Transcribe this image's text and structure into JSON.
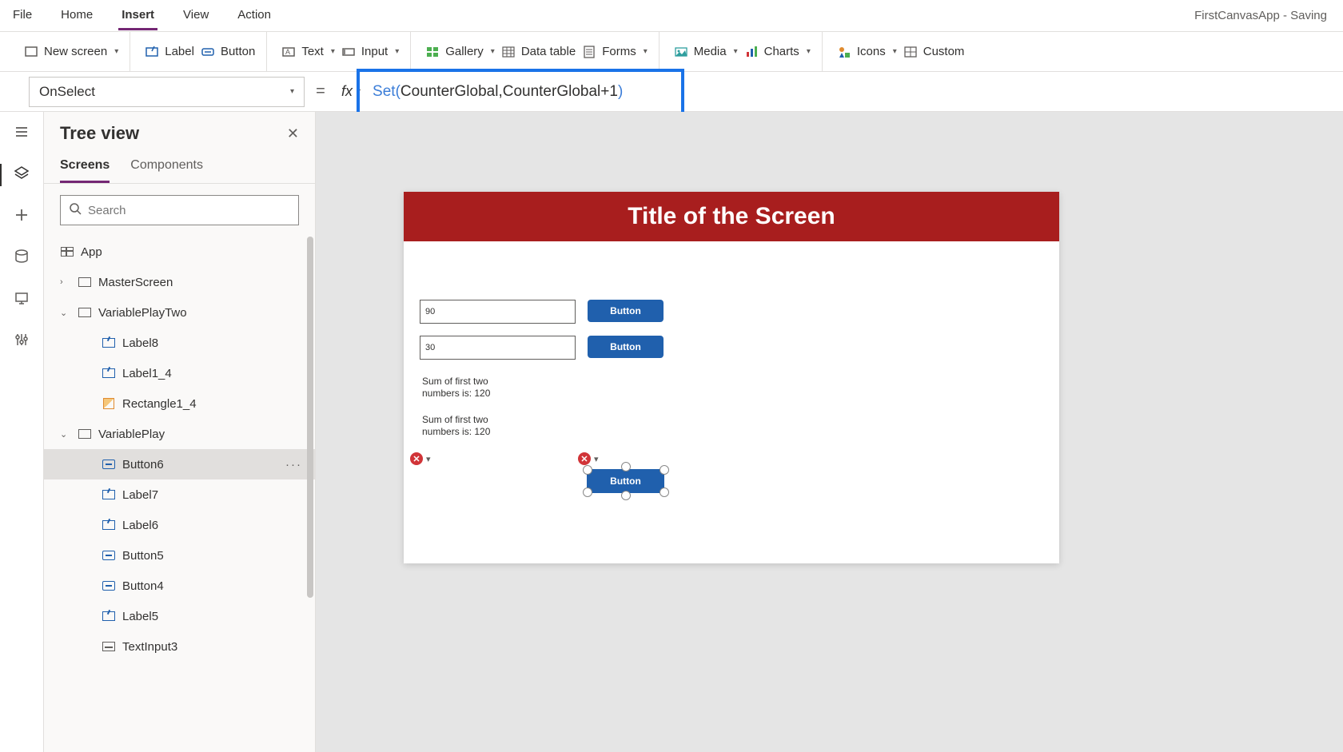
{
  "menubar": {
    "tabs": [
      "File",
      "Home",
      "Insert",
      "View",
      "Action"
    ],
    "active_index": 2,
    "app_status": "FirstCanvasApp - Saving"
  },
  "ribbon": {
    "groups": [
      {
        "items": [
          {
            "icon": "newscreen",
            "label": "New screen",
            "dropdown": true
          }
        ]
      },
      {
        "items": [
          {
            "icon": "label",
            "label": "Label",
            "dropdown": false
          },
          {
            "icon": "button",
            "label": "Button",
            "dropdown": false
          }
        ]
      },
      {
        "items": [
          {
            "icon": "text",
            "label": "Text",
            "dropdown": true
          },
          {
            "icon": "input",
            "label": "Input",
            "dropdown": true
          }
        ]
      },
      {
        "items": [
          {
            "icon": "gallery",
            "label": "Gallery",
            "dropdown": true
          },
          {
            "icon": "datatable",
            "label": "Data table",
            "dropdown": false
          },
          {
            "icon": "forms",
            "label": "Forms",
            "dropdown": true
          }
        ]
      },
      {
        "items": [
          {
            "icon": "media",
            "label": "Media",
            "dropdown": true
          },
          {
            "icon": "charts",
            "label": "Charts",
            "dropdown": true
          }
        ]
      },
      {
        "items": [
          {
            "icon": "icons",
            "label": "Icons",
            "dropdown": true
          },
          {
            "icon": "custom",
            "label": "Custom",
            "dropdown": false
          }
        ]
      }
    ]
  },
  "formulabar": {
    "property": "OnSelect",
    "equals": "=",
    "fx": "fx",
    "formula_parts": [
      {
        "t": "fn",
        "v": "Set"
      },
      {
        "t": "paren",
        "v": "("
      },
      {
        "t": "id",
        "v": "CounterGlobal"
      },
      {
        "t": "op",
        "v": ", "
      },
      {
        "t": "id",
        "v": "CounterGlobal"
      },
      {
        "t": "op",
        "v": " + "
      },
      {
        "t": "num",
        "v": "1"
      },
      {
        "t": "paren",
        "v": ")"
      }
    ]
  },
  "leftrail": {
    "buttons": [
      "hamburger",
      "layers",
      "plus",
      "data",
      "monitor",
      "settings"
    ]
  },
  "treepanel": {
    "title": "Tree view",
    "tabs": [
      "Screens",
      "Components"
    ],
    "active_tab": 0,
    "search_placeholder": "Search",
    "items": [
      {
        "indent": 0,
        "icon": "app",
        "label": "App",
        "expandable": false
      },
      {
        "indent": 1,
        "icon": "screen",
        "label": "MasterScreen",
        "expandable": true,
        "expanded": false
      },
      {
        "indent": 1,
        "icon": "screen",
        "label": "VariablePlayTwo",
        "expandable": true,
        "expanded": true
      },
      {
        "indent": 2,
        "icon": "label",
        "label": "Label8"
      },
      {
        "indent": 2,
        "icon": "label",
        "label": "Label1_4"
      },
      {
        "indent": 2,
        "icon": "shape",
        "label": "Rectangle1_4"
      },
      {
        "indent": 1,
        "icon": "screen",
        "label": "VariablePlay",
        "expandable": true,
        "expanded": true
      },
      {
        "indent": 2,
        "icon": "button",
        "label": "Button6",
        "selected": true
      },
      {
        "indent": 2,
        "icon": "label",
        "label": "Label7"
      },
      {
        "indent": 2,
        "icon": "label",
        "label": "Label6"
      },
      {
        "indent": 2,
        "icon": "button",
        "label": "Button5"
      },
      {
        "indent": 2,
        "icon": "button",
        "label": "Button4"
      },
      {
        "indent": 2,
        "icon": "label",
        "label": "Label5"
      },
      {
        "indent": 2,
        "icon": "textinput",
        "label": "TextInput3"
      }
    ]
  },
  "canvas": {
    "screen_title": "Title of the Screen",
    "input1": "90",
    "input2": "30",
    "btn1": "Button",
    "btn2": "Button",
    "btn3": "Button",
    "label1_line1": "Sum of first two",
    "label1_line2": "numbers is: 120",
    "label2_line1": "Sum of first two",
    "label2_line2": "numbers is: 120",
    "error_x": "✕"
  }
}
